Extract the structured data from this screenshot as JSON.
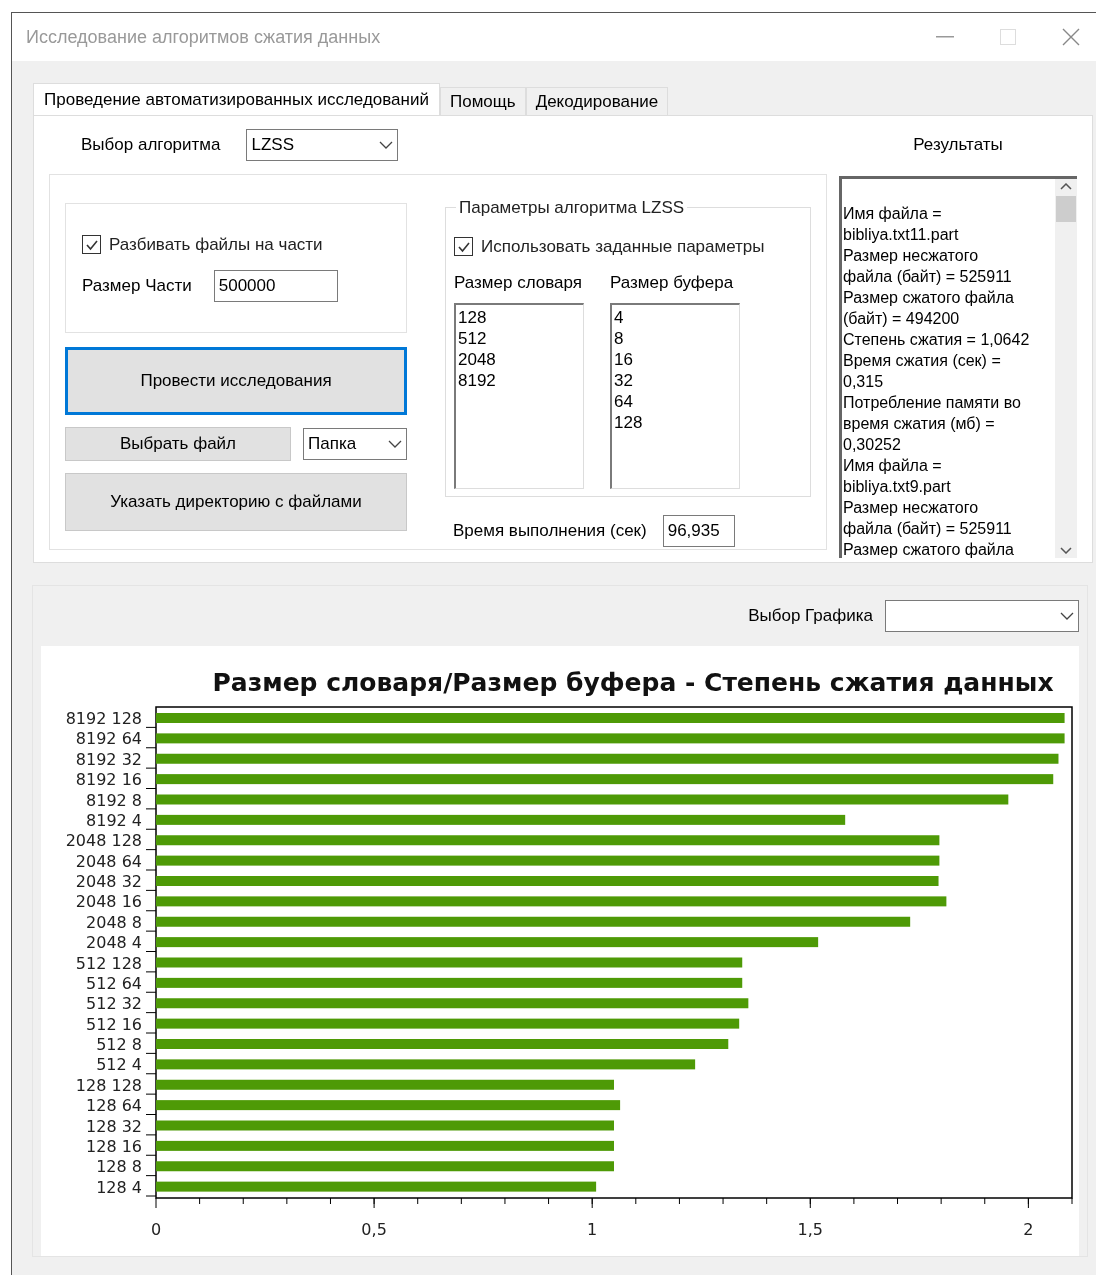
{
  "window": {
    "title": "Исследование алгоритмов сжатия данных"
  },
  "tabs": [
    {
      "label": "Проведение автоматизированных исследований",
      "selected": true
    },
    {
      "label": "Помощь",
      "selected": false
    },
    {
      "label": "Декодирование",
      "selected": false
    }
  ],
  "algorithm": {
    "label": "Выбор алгоритма",
    "value": "LZSS"
  },
  "split": {
    "label": "Разбивать файлы на части",
    "checked": true
  },
  "part_size": {
    "label": "Размер Части",
    "value": "500000"
  },
  "run_button": "Провести исследования",
  "choose_file_button": "Выбрать файл",
  "source_select": {
    "value": "Папка"
  },
  "dir_button": "Указать директорию с файлами",
  "params": {
    "title": "Параметры алгоритма LZSS",
    "use_params": {
      "label": "Использовать заданные параметры",
      "checked": true
    },
    "dict_label": "Размер словаря",
    "dict_items": [
      "128",
      "512",
      "2048",
      "8192"
    ],
    "buffer_label": "Размер буфера",
    "buffer_items": [
      "4",
      "8",
      "16",
      "32",
      "64",
      "128"
    ]
  },
  "exec_time": {
    "label": "Время выполнения (сек)",
    "value": "96,935"
  },
  "results": {
    "title": "Результаты",
    "lines": [
      "Имя файла =",
      "bibliya.txt11.part",
      "Размер несжатого",
      "файла (байт) = 525911",
      "Размер сжатого файла",
      "(байт) = 494200",
      "Степень сжатия = 1,0642",
      "Время сжатия (сек) =",
      "0,315",
      "Потребление памяти во",
      "время сжатия (мб)  =",
      "0,30252",
      "Имя файла =",
      "bibliya.txt9.part",
      "Размер несжатого",
      "файла (байт) = 525911",
      "Размер сжатого файла"
    ]
  },
  "chart_select": {
    "label": "Выбор Графика"
  },
  "chart": {
    "chart_data": {
      "type": "bar",
      "orientation": "horizontal",
      "title": "Размер словаря/Размер буфера - Степень сжатия данных",
      "categories": [
        "8192 128",
        "8192 64",
        "8192 32",
        "8192 16",
        "8192 8",
        "8192 4",
        "2048 128",
        "2048 64",
        "2048 32",
        "2048 16",
        "2048 8",
        "2048 4",
        "512 128",
        "512 64",
        "512 32",
        "512 16",
        "512 8",
        "512 4",
        "128 128",
        "128 64",
        "128 32",
        "128 16",
        "128 8",
        "128 4"
      ],
      "series": [
        {
          "color": "#4e9a06",
          "values": [
            2.083,
            2.083,
            2.069,
            2.057,
            1.954,
            1.58,
            1.796,
            1.796,
            1.794,
            1.812,
            1.729,
            1.518,
            1.344,
            1.344,
            1.358,
            1.337,
            1.312,
            1.236,
            1.05,
            1.064,
            1.05,
            1.05,
            1.05,
            1.009
          ]
        }
      ],
      "xlim": [
        0,
        2.1
      ],
      "xticks": [
        {
          "value": 0,
          "label": "0"
        },
        {
          "value": 0.5,
          "label": "0,5"
        },
        {
          "value": 1,
          "label": "1"
        },
        {
          "value": 1.5,
          "label": "1,5"
        },
        {
          "value": 2,
          "label": "2"
        }
      ]
    }
  }
}
